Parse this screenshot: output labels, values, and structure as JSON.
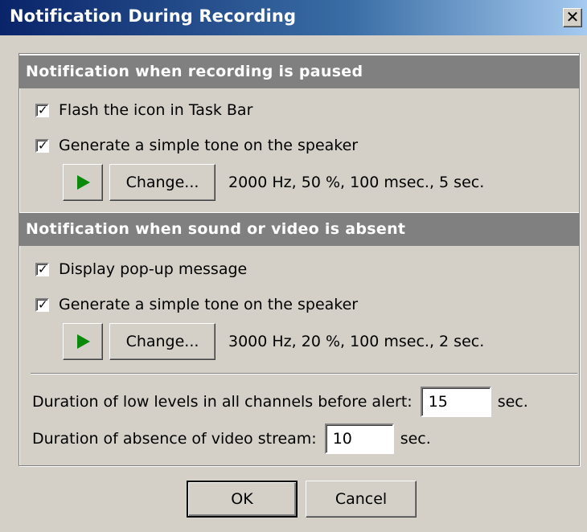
{
  "window": {
    "title": "Notification During Recording",
    "close_glyph": "✕"
  },
  "paused_section": {
    "header": "Notification when recording is paused",
    "options": [
      {
        "label": "Flash the icon in Task Bar",
        "checked": true
      },
      {
        "label": "Generate a simple tone on the speaker",
        "checked": true
      }
    ],
    "play_icon": "play-icon",
    "change_label": "Change...",
    "tone_settings": "2000 Hz, 50 %, 100 msec., 5 sec."
  },
  "absent_section": {
    "header": "Notification when sound or video is absent",
    "options": [
      {
        "label": "Display pop-up message",
        "checked": true
      },
      {
        "label": "Generate a simple tone on the speaker",
        "checked": true
      }
    ],
    "play_icon": "play-icon",
    "change_label": "Change...",
    "tone_settings": "3000 Hz, 20 %, 100 msec., 2 sec.",
    "low_levels": {
      "label": "Duration of low levels in all channels before alert:",
      "value": "15",
      "unit": "sec."
    },
    "video_absence": {
      "label": "Duration of absence of video stream:",
      "value": "10",
      "unit": "sec."
    }
  },
  "buttons": {
    "ok": "OK",
    "cancel": "Cancel"
  },
  "colors": {
    "play_green": "#0a8a0a",
    "section_header": "#808080",
    "dialog_bg": "#d4d0c8"
  }
}
